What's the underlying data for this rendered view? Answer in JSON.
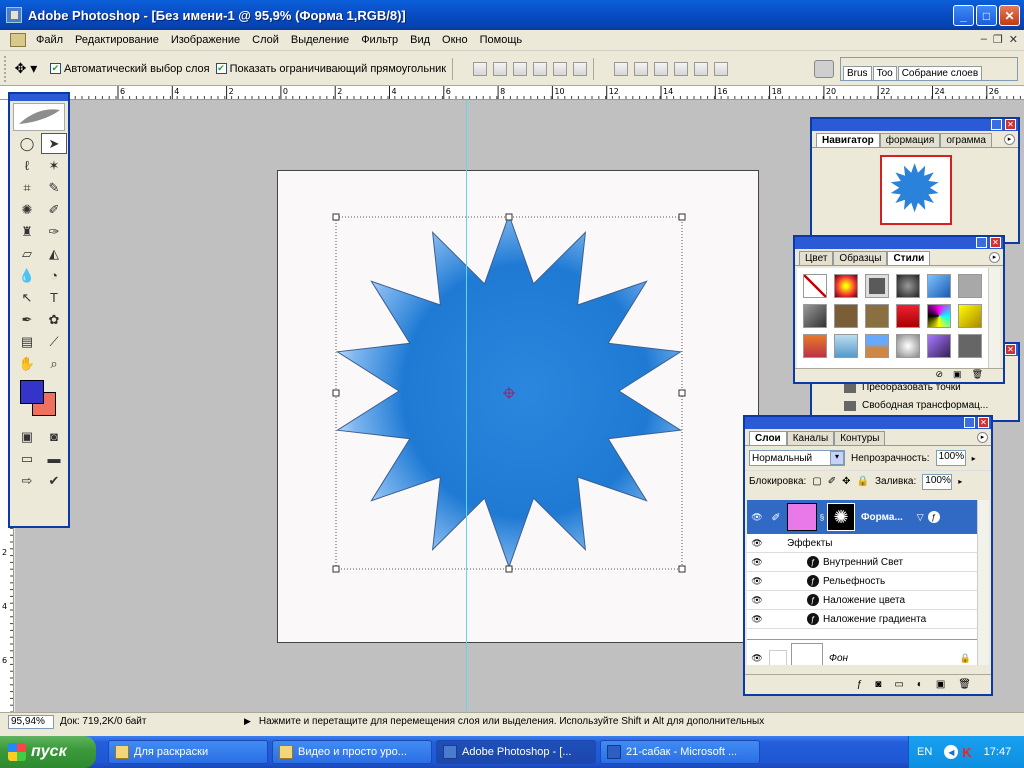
{
  "window": {
    "title": "Adobe Photoshop - [Без имени-1 @ 95,9% (Форма 1,RGB/8)]"
  },
  "menu": [
    "Файл",
    "Редактирование",
    "Изображение",
    "Слой",
    "Выделение",
    "Фильтр",
    "Вид",
    "Окно",
    "Помощь"
  ],
  "options": {
    "auto_select_label": "Автоматический выбор слоя",
    "auto_select_checked": true,
    "show_bounds_label": "Показать ограничивающий прямоугольник",
    "show_bounds_checked": true,
    "well_tabs": [
      "Brus",
      "Too",
      "Собрание слоев"
    ]
  },
  "ruler_top": [
    "6",
    "4",
    "2",
    "0",
    "2",
    "4",
    "6",
    "8",
    "10",
    "12",
    "14",
    "16",
    "18",
    "20",
    "22",
    "24",
    "26"
  ],
  "ruler_left": [
    "2",
    "4",
    "6"
  ],
  "tools": {
    "foreground_color": "#3434c8",
    "background_color": "#f07060"
  },
  "navigator": {
    "tabs": [
      "Навигатор",
      "формация",
      "ограмма"
    ]
  },
  "styles_panel": {
    "tabs": [
      "Цвет",
      "Образцы",
      "Стили"
    ]
  },
  "history_items": [
    "Преобразовать точки",
    "Свободная трансформац..."
  ],
  "layers": {
    "tabs": [
      "Слои",
      "Каналы",
      "Контуры"
    ],
    "blend_mode": "Нормальный",
    "opacity_label": "Непрозрачность:",
    "opacity_value": "100%",
    "lock_label": "Блокировка:",
    "fill_label": "Заливка:",
    "fill_value": "100%",
    "shape_layer_name": "Форма...",
    "effects_label": "Эффекты",
    "effects": [
      "Внутренний Свет",
      "Рельефность",
      "Наложение цвета",
      "Наложение градиента"
    ],
    "background_layer_name": "Фон"
  },
  "status": {
    "zoom": "95,94%",
    "doc_info": "Док: 719,2K/0 байт",
    "hint": "Нажмите и перетащите для перемещения слоя или выделения. Используйте Shift и Alt для дополнительных"
  },
  "taskbar": {
    "start_label": "пуск",
    "items": [
      "Для раскраски",
      "Видео и просто уро...",
      "Adobe Photoshop - [...",
      "21-сабак - Microsoft ..."
    ],
    "lang": "EN",
    "time": "17:47"
  }
}
